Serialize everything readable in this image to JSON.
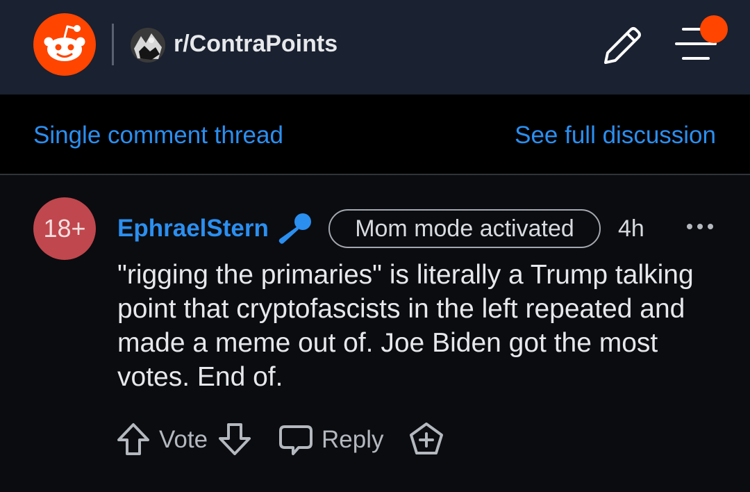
{
  "header": {
    "logo_icon": "reddit-snoo-icon",
    "subreddit_name": "r/ContraPoints",
    "create_post_icon": "pencil-icon",
    "menu_icon": "hamburger-menu-icon",
    "notification_color": "#ff4500"
  },
  "thread_nav": {
    "single_thread_label": "Single comment thread",
    "full_discussion_label": "See full discussion"
  },
  "comment": {
    "avatar_badge": "18+",
    "username": "EphraelStern",
    "user_badge_icon": "microphone-icon",
    "flair": "Mom mode activated",
    "timestamp": "4h",
    "body": "\"rigging the primaries\" is literally a Trump talking point that cryptofascists in the left repeated and made a meme out of. Joe Biden got the most votes. End of.",
    "actions": {
      "vote_label": "Vote",
      "reply_label": "Reply"
    }
  },
  "colors": {
    "header_bg": "#1a2130",
    "accent_link": "#2b8ff0",
    "reddit_orange": "#ff4500",
    "nsfw_avatar": "#c0474d",
    "page_bg": "#0b0c10"
  }
}
